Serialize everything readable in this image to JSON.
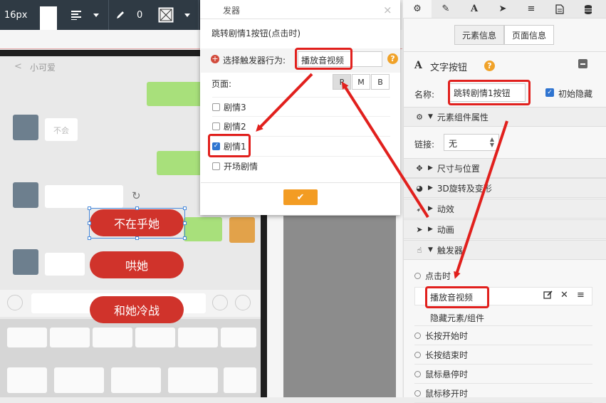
{
  "toolbar": {
    "font_size": "16px",
    "stroke_width": "0"
  },
  "chat": {
    "title": "小可爱",
    "left_bubble_1": "不会",
    "choices": [
      "不在乎她",
      "哄她",
      "和她冷战"
    ]
  },
  "dialog": {
    "title": "发器",
    "subtitle": "跳转剧情1按钮(点击时)",
    "behavior_label": "选择触发器行为:",
    "behavior_value": "播放音视频",
    "page_label": "页面:",
    "page_buttons": [
      "P",
      "M",
      "B"
    ],
    "options": [
      {
        "label": "剧情3",
        "checked": false
      },
      {
        "label": "剧情2",
        "checked": false
      },
      {
        "label": "剧情1",
        "checked": true
      },
      {
        "label": "开场剧情",
        "checked": false
      }
    ],
    "ok_icon": "check-icon"
  },
  "panel": {
    "info_tabs": [
      "元素信息",
      "页面信息"
    ],
    "element_type": "文字按钮",
    "name_label": "名称:",
    "name_value": "跳转剧情1按钮",
    "hide_label": "初始隐藏",
    "component_props": "元素组件属性",
    "link_label": "链接:",
    "link_value": "无",
    "sections": [
      "尺寸与位置",
      "3D旋转及变形",
      "动效",
      "动画",
      "触发器"
    ],
    "events": {
      "click": "点击时",
      "actions": [
        "播放音视频",
        "隐藏元素/组件"
      ],
      "others": [
        "长按开始时",
        "长按结束时",
        "鼠标悬停时",
        "鼠标移开时"
      ]
    }
  },
  "colors": {
    "highlight": "#e1201d",
    "choice_button": "#d0332b",
    "ok_button": "#f39c23",
    "toolbar": "#2f3a44"
  }
}
